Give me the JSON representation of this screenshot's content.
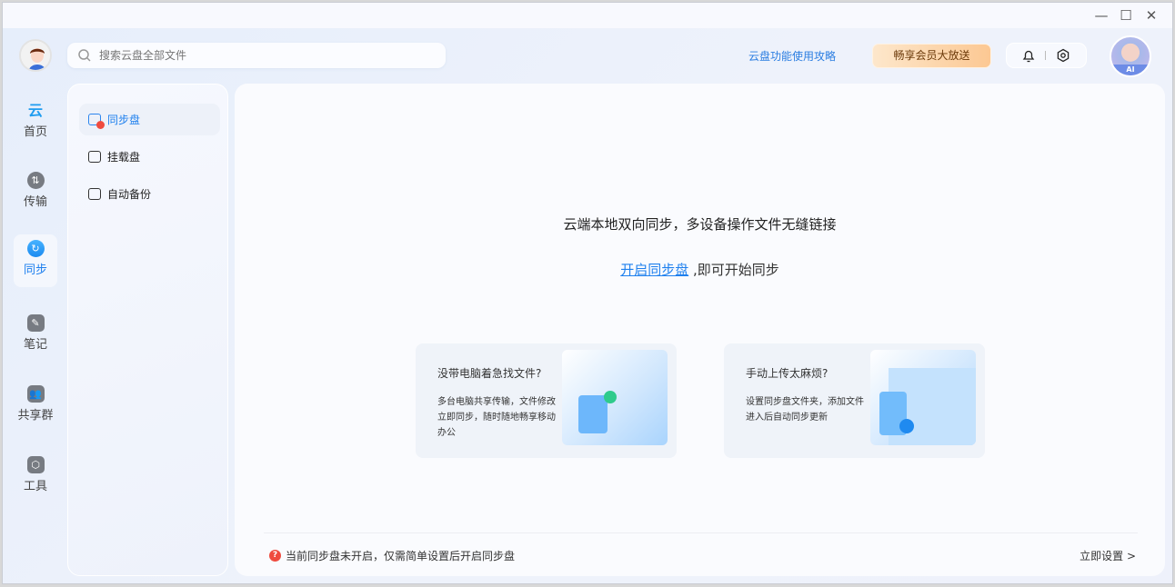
{
  "window": {
    "minimize": "—",
    "maximize": "☐",
    "close": "✕"
  },
  "header": {
    "search_placeholder": "搜索云盘全部文件",
    "guide_link": "云盘功能使用攻略",
    "vip_button": "畅享会员大放送",
    "ai_badge": "AI"
  },
  "nav": [
    {
      "label": "首页"
    },
    {
      "label": "传输"
    },
    {
      "label": "同步"
    },
    {
      "label": "笔记"
    },
    {
      "label": "共享群"
    },
    {
      "label": "工具"
    }
  ],
  "subnav": [
    {
      "label": "同步盘"
    },
    {
      "label": "挂载盘"
    },
    {
      "label": "自动备份"
    }
  ],
  "main": {
    "headline": "云端本地双向同步，多设备操作文件无缝链接",
    "link": "开启同步盘",
    "link_suffix": " ,即可开始同步",
    "cards": [
      {
        "title": "没带电脑着急找文件?",
        "desc": "多台电脑共享传输，文件修改立即同步，随时随地畅享移动办公"
      },
      {
        "title": "手动上传太麻烦?",
        "desc": "设置同步盘文件夹，添加文件进入后自动同步更新"
      }
    ],
    "footer_text": "当前同步盘未开启，仅需简单设置后开启同步盘",
    "footer_action": "立即设置 >"
  },
  "colors": {
    "accent": "#1f80ee",
    "warning": "#ef4b3f",
    "vip_start": "#fde7cb",
    "vip_end": "#fcc893"
  }
}
